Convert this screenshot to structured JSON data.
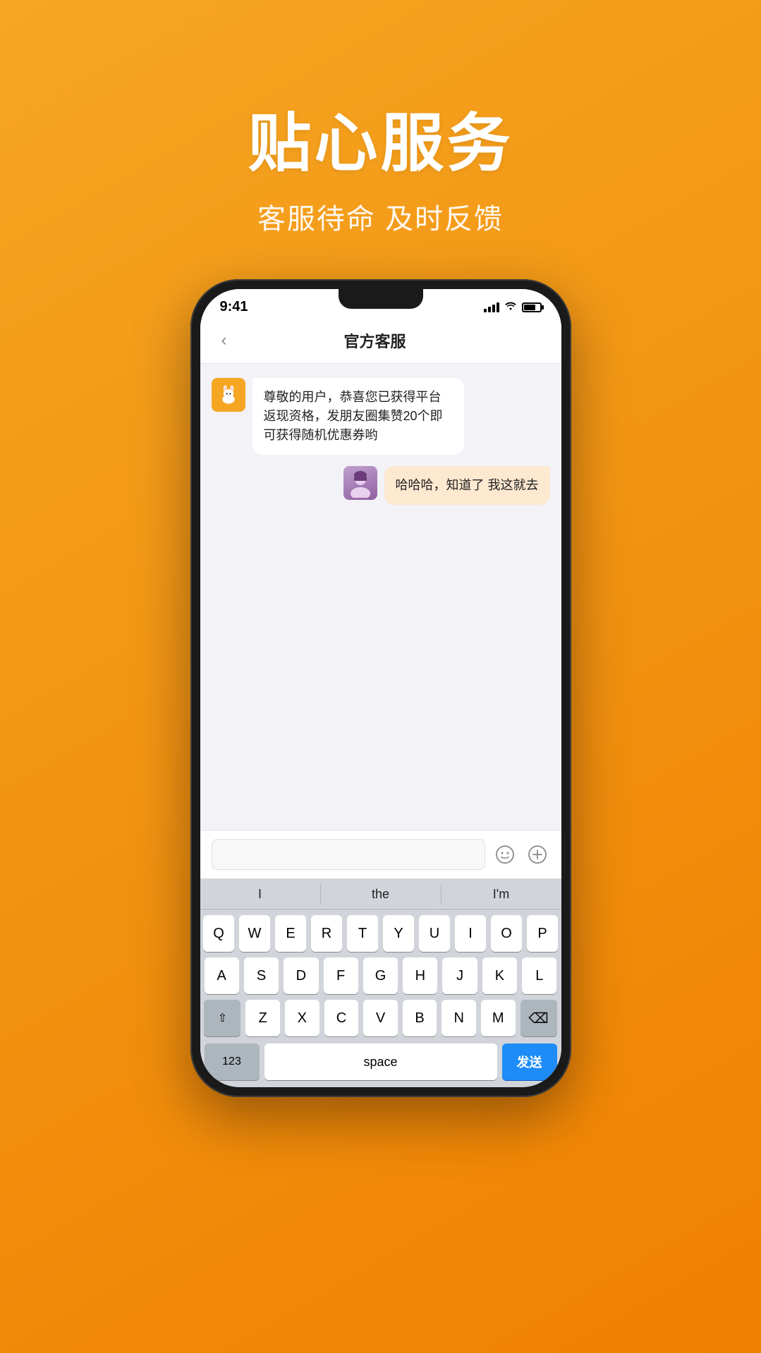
{
  "header": {
    "main_title": "贴心服务",
    "sub_title": "客服待命 及时反馈"
  },
  "status_bar": {
    "time": "9:41"
  },
  "nav": {
    "back_label": "‹",
    "title": "官方客服"
  },
  "messages": [
    {
      "id": "msg1",
      "side": "left",
      "text": "尊敬的用户，恭喜您已获得平台返现资格，发朋友圈集赞20个即可获得随机优惠券哟"
    },
    {
      "id": "msg2",
      "side": "right",
      "text": "哈哈哈，知道了 我这就去"
    }
  ],
  "input": {
    "placeholder": ""
  },
  "keyboard": {
    "suggestions": [
      "I",
      "the",
      "I'm"
    ],
    "row1": [
      "Q",
      "W",
      "E",
      "R",
      "T",
      "Y",
      "U",
      "I",
      "O",
      "P"
    ],
    "row2": [
      "A",
      "S",
      "D",
      "F",
      "G",
      "H",
      "J",
      "K",
      "L"
    ],
    "row3": [
      "Z",
      "X",
      "C",
      "V",
      "B",
      "N",
      "M"
    ],
    "bottom": {
      "num_label": "123",
      "space_label": "space",
      "send_label": "发送"
    }
  }
}
